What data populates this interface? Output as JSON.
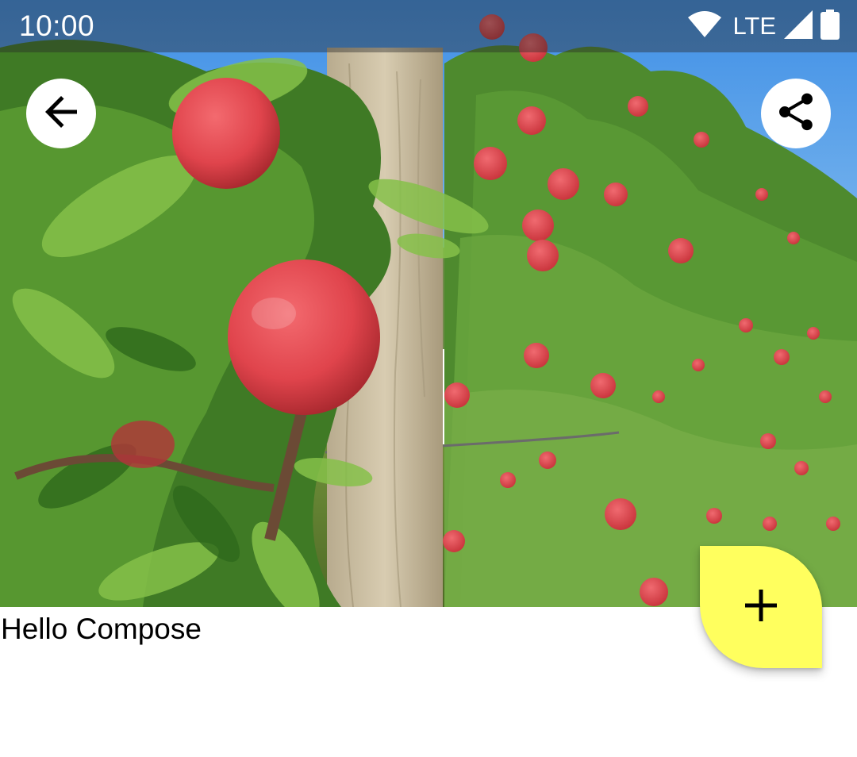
{
  "status_bar": {
    "time": "10:00",
    "network": "LTE",
    "wifi_icon": "wifi-icon",
    "signal_icon": "cell-signal-icon",
    "battery_icon": "battery-icon"
  },
  "toolbar": {
    "back_icon": "arrow-back-icon",
    "share_icon": "share-icon"
  },
  "hero_image": {
    "subject": "apple-orchard-photo"
  },
  "content": {
    "greeting": "Hello Compose"
  },
  "fab": {
    "icon": "plus-icon",
    "color": "#FFFF5E"
  },
  "colors": {
    "status_bar_scrim": "#282828",
    "background": "#FFFFFF",
    "text": "#000000"
  }
}
